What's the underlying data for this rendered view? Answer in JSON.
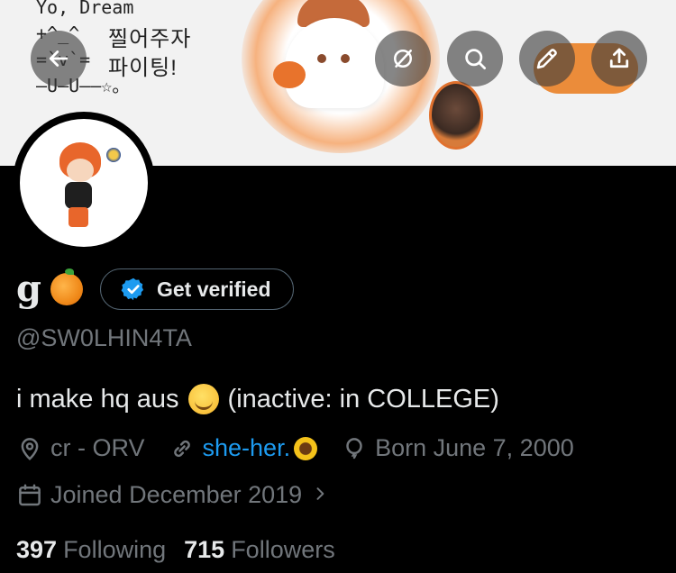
{
  "banner": {
    "text_lines": "Yo, Dream\n+^_^\n=`v`=\n—U—U——☆。",
    "hangul_lines": "찔어주자\n파이팅!"
  },
  "actions": {
    "back_icon": "arrow-left-icon",
    "mute_icon": "slashed-circle-icon",
    "search_icon": "search-icon",
    "edit_icon": "pencil-icon",
    "share_icon": "share-icon"
  },
  "profile": {
    "display_name": "g",
    "name_emoji": "tangerine",
    "verify_label": "Get verified",
    "handle": "@SW0LHIN4TA",
    "bio_before": "i make hq aus",
    "bio_emoji": "smiling-face",
    "bio_after": "(inactive: in COLLEGE)",
    "location": "cr - ORV",
    "link": "she-her.",
    "link_emoji": "sunflower",
    "birthday": "Born June 7, 2000",
    "joined": "Joined December 2019",
    "following_count": "397",
    "following_label": "Following",
    "followers_count": "715",
    "followers_label": "Followers"
  },
  "colors": {
    "background": "#000000",
    "text_primary": "#e7e9ea",
    "text_secondary": "#71767b",
    "link": "#1d9bf0",
    "verified": "#1d9bf0"
  }
}
